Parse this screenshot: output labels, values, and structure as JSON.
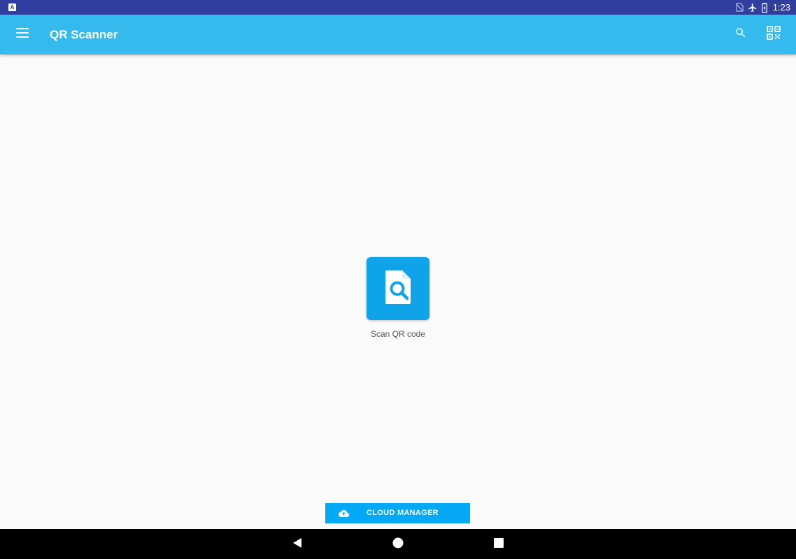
{
  "status_bar": {
    "time": "1:23",
    "left_icon_letter": "A",
    "icons": [
      "notification-icon",
      "no-sim-icon",
      "airplane-mode-icon",
      "battery-charging-icon"
    ]
  },
  "app_bar": {
    "title": "QR Scanner",
    "background_color": "#35baed",
    "icons": [
      "menu-icon",
      "search-icon",
      "qr-code-icon"
    ]
  },
  "main": {
    "scan_tile": {
      "label": "Scan QR code",
      "icon": "document-search-icon",
      "color": "#0fa3ea"
    }
  },
  "bottom": {
    "cloud_button": {
      "label": "CLOUD MANAGER",
      "icon": "cloud-upload-icon",
      "color": "#03a9f4"
    }
  },
  "nav_bar": {
    "icons": [
      "back-icon",
      "home-icon",
      "recents-icon"
    ]
  }
}
